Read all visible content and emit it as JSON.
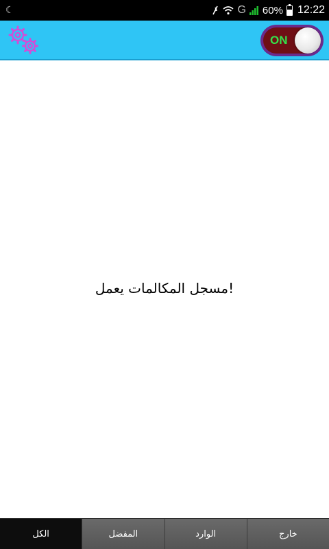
{
  "status_bar": {
    "left_icon": "moon-icon",
    "network": "G",
    "battery_percent": "60%",
    "battery_level": 0.6,
    "time": "12:22"
  },
  "app_bar": {
    "settings_icon": "gears-icon",
    "toggle_label": "ON",
    "toggle_state": true,
    "colors": {
      "bar": "#2fc5f5",
      "gears": "#d24dd8",
      "toggle_text": "#35e24b"
    }
  },
  "main": {
    "message": "!مسجل المكالمات يعمل"
  },
  "tabs": [
    {
      "label": "الكل",
      "active": true
    },
    {
      "label": "المفضل",
      "active": false
    },
    {
      "label": "الوارد",
      "active": false
    },
    {
      "label": "خارج",
      "active": false
    }
  ]
}
